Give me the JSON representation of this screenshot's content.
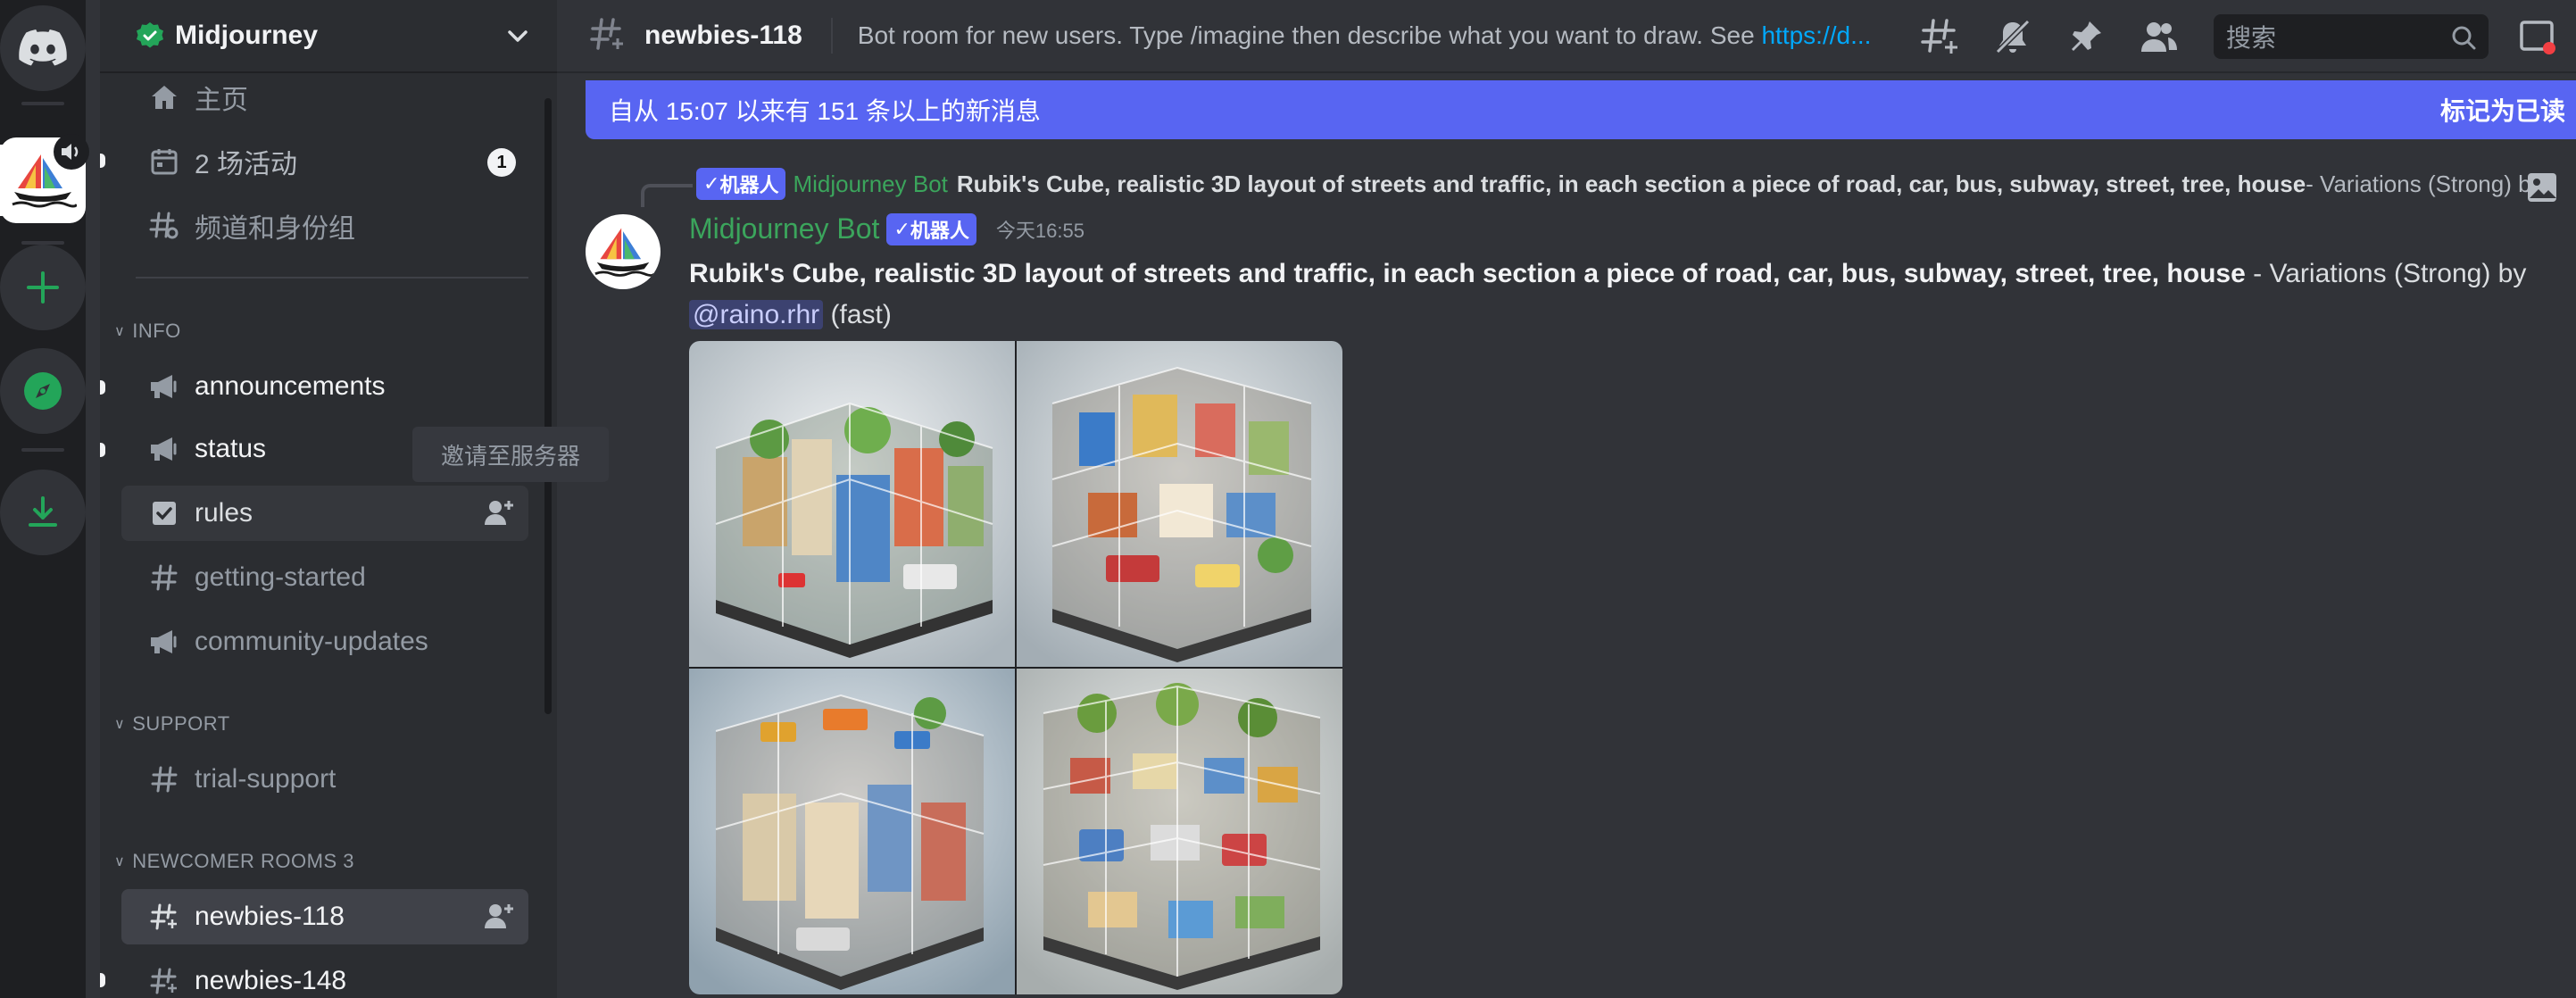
{
  "rail": {
    "items": [
      {
        "name": "discord-home",
        "label": "Discord"
      },
      {
        "name": "midjourney-server",
        "label": "Midjourney"
      },
      {
        "name": "add-server",
        "label": "Add a Server"
      },
      {
        "name": "explore",
        "label": "Explore"
      },
      {
        "name": "download",
        "label": "Download"
      }
    ]
  },
  "server": {
    "name": "Midjourney"
  },
  "sidebar": {
    "top_items": [
      {
        "label": "主页",
        "icon": "home-icon"
      },
      {
        "label": "2 场活动",
        "icon": "calendar-icon",
        "badge": "1"
      },
      {
        "label": "频道和身份组",
        "icon": "channels-roles-icon"
      }
    ],
    "categories": [
      {
        "label": "INFO"
      },
      {
        "label": "SUPPORT"
      },
      {
        "label": "NEWCOMER ROOMS 3"
      }
    ],
    "channels": [
      {
        "label": "announcements",
        "icon": "megaphone-icon"
      },
      {
        "label": "status",
        "icon": "megaphone-icon"
      },
      {
        "label": "rules",
        "icon": "checkbox-icon"
      },
      {
        "label": "getting-started",
        "icon": "hashtag-icon"
      },
      {
        "label": "community-updates",
        "icon": "megaphone-icon"
      },
      {
        "label": "trial-support",
        "icon": "hashtag-icon"
      },
      {
        "label": "newbies-118",
        "icon": "thread-hashtag-icon"
      },
      {
        "label": "newbies-148",
        "icon": "thread-hashtag-icon"
      }
    ],
    "tooltip": "邀请至服务器"
  },
  "topbar": {
    "channel": "newbies-118",
    "topic_text": "Bot room for new users. Type /imagine then describe what you want to draw. See ",
    "topic_link": "https://d...",
    "search_placeholder": "搜索"
  },
  "banner": {
    "text": "自从 15:07 以来有 151 条以上的新消息",
    "action": "标记为已读"
  },
  "message": {
    "reply": {
      "tag": "机器人",
      "author": "Midjourney Bot",
      "prompt": "Rubik's Cube, realistic 3D layout of streets and traffic, in each section a piece of road, car, bus, subway, street, tree, house",
      "suffix": " - Variations (Strong) by @raino.rhr (fast)"
    },
    "author": "Midjourney Bot",
    "tag": "机器人",
    "time": "今天16:55",
    "prompt": "Rubik's Cube, realistic 3D layout of streets and traffic, in each section a piece of road, car, bus, subway, street, tree, house",
    "after_prompt": " - Variations (Strong) by ",
    "mention": "@raino.rhr",
    "speed": " (fast)"
  },
  "colors": {
    "accent": "#5865f2",
    "bot_green": "#3ba55c",
    "link": "#00a8fc",
    "background": "#313338",
    "sidebar": "#2b2d31",
    "rail": "#1e1f22"
  }
}
